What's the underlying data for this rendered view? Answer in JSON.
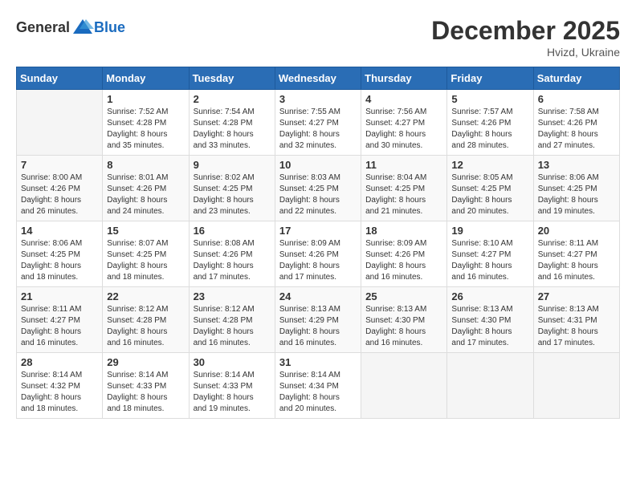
{
  "header": {
    "logo": {
      "general": "General",
      "blue": "Blue"
    },
    "title": "December 2025",
    "location": "Hvizd, Ukraine"
  },
  "calendar": {
    "days_of_week": [
      "Sunday",
      "Monday",
      "Tuesday",
      "Wednesday",
      "Thursday",
      "Friday",
      "Saturday"
    ],
    "weeks": [
      [
        {
          "day": "",
          "info": ""
        },
        {
          "day": "1",
          "info": "Sunrise: 7:52 AM\nSunset: 4:28 PM\nDaylight: 8 hours\nand 35 minutes."
        },
        {
          "day": "2",
          "info": "Sunrise: 7:54 AM\nSunset: 4:28 PM\nDaylight: 8 hours\nand 33 minutes."
        },
        {
          "day": "3",
          "info": "Sunrise: 7:55 AM\nSunset: 4:27 PM\nDaylight: 8 hours\nand 32 minutes."
        },
        {
          "day": "4",
          "info": "Sunrise: 7:56 AM\nSunset: 4:27 PM\nDaylight: 8 hours\nand 30 minutes."
        },
        {
          "day": "5",
          "info": "Sunrise: 7:57 AM\nSunset: 4:26 PM\nDaylight: 8 hours\nand 28 minutes."
        },
        {
          "day": "6",
          "info": "Sunrise: 7:58 AM\nSunset: 4:26 PM\nDaylight: 8 hours\nand 27 minutes."
        }
      ],
      [
        {
          "day": "7",
          "info": "Sunrise: 8:00 AM\nSunset: 4:26 PM\nDaylight: 8 hours\nand 26 minutes."
        },
        {
          "day": "8",
          "info": "Sunrise: 8:01 AM\nSunset: 4:26 PM\nDaylight: 8 hours\nand 24 minutes."
        },
        {
          "day": "9",
          "info": "Sunrise: 8:02 AM\nSunset: 4:25 PM\nDaylight: 8 hours\nand 23 minutes."
        },
        {
          "day": "10",
          "info": "Sunrise: 8:03 AM\nSunset: 4:25 PM\nDaylight: 8 hours\nand 22 minutes."
        },
        {
          "day": "11",
          "info": "Sunrise: 8:04 AM\nSunset: 4:25 PM\nDaylight: 8 hours\nand 21 minutes."
        },
        {
          "day": "12",
          "info": "Sunrise: 8:05 AM\nSunset: 4:25 PM\nDaylight: 8 hours\nand 20 minutes."
        },
        {
          "day": "13",
          "info": "Sunrise: 8:06 AM\nSunset: 4:25 PM\nDaylight: 8 hours\nand 19 minutes."
        }
      ],
      [
        {
          "day": "14",
          "info": "Sunrise: 8:06 AM\nSunset: 4:25 PM\nDaylight: 8 hours\nand 18 minutes."
        },
        {
          "day": "15",
          "info": "Sunrise: 8:07 AM\nSunset: 4:25 PM\nDaylight: 8 hours\nand 18 minutes."
        },
        {
          "day": "16",
          "info": "Sunrise: 8:08 AM\nSunset: 4:26 PM\nDaylight: 8 hours\nand 17 minutes."
        },
        {
          "day": "17",
          "info": "Sunrise: 8:09 AM\nSunset: 4:26 PM\nDaylight: 8 hours\nand 17 minutes."
        },
        {
          "day": "18",
          "info": "Sunrise: 8:09 AM\nSunset: 4:26 PM\nDaylight: 8 hours\nand 16 minutes."
        },
        {
          "day": "19",
          "info": "Sunrise: 8:10 AM\nSunset: 4:27 PM\nDaylight: 8 hours\nand 16 minutes."
        },
        {
          "day": "20",
          "info": "Sunrise: 8:11 AM\nSunset: 4:27 PM\nDaylight: 8 hours\nand 16 minutes."
        }
      ],
      [
        {
          "day": "21",
          "info": "Sunrise: 8:11 AM\nSunset: 4:27 PM\nDaylight: 8 hours\nand 16 minutes."
        },
        {
          "day": "22",
          "info": "Sunrise: 8:12 AM\nSunset: 4:28 PM\nDaylight: 8 hours\nand 16 minutes."
        },
        {
          "day": "23",
          "info": "Sunrise: 8:12 AM\nSunset: 4:28 PM\nDaylight: 8 hours\nand 16 minutes."
        },
        {
          "day": "24",
          "info": "Sunrise: 8:13 AM\nSunset: 4:29 PM\nDaylight: 8 hours\nand 16 minutes."
        },
        {
          "day": "25",
          "info": "Sunrise: 8:13 AM\nSunset: 4:30 PM\nDaylight: 8 hours\nand 16 minutes."
        },
        {
          "day": "26",
          "info": "Sunrise: 8:13 AM\nSunset: 4:30 PM\nDaylight: 8 hours\nand 17 minutes."
        },
        {
          "day": "27",
          "info": "Sunrise: 8:13 AM\nSunset: 4:31 PM\nDaylight: 8 hours\nand 17 minutes."
        }
      ],
      [
        {
          "day": "28",
          "info": "Sunrise: 8:14 AM\nSunset: 4:32 PM\nDaylight: 8 hours\nand 18 minutes."
        },
        {
          "day": "29",
          "info": "Sunrise: 8:14 AM\nSunset: 4:33 PM\nDaylight: 8 hours\nand 18 minutes."
        },
        {
          "day": "30",
          "info": "Sunrise: 8:14 AM\nSunset: 4:33 PM\nDaylight: 8 hours\nand 19 minutes."
        },
        {
          "day": "31",
          "info": "Sunrise: 8:14 AM\nSunset: 4:34 PM\nDaylight: 8 hours\nand 20 minutes."
        },
        {
          "day": "",
          "info": ""
        },
        {
          "day": "",
          "info": ""
        },
        {
          "day": "",
          "info": ""
        }
      ]
    ]
  }
}
